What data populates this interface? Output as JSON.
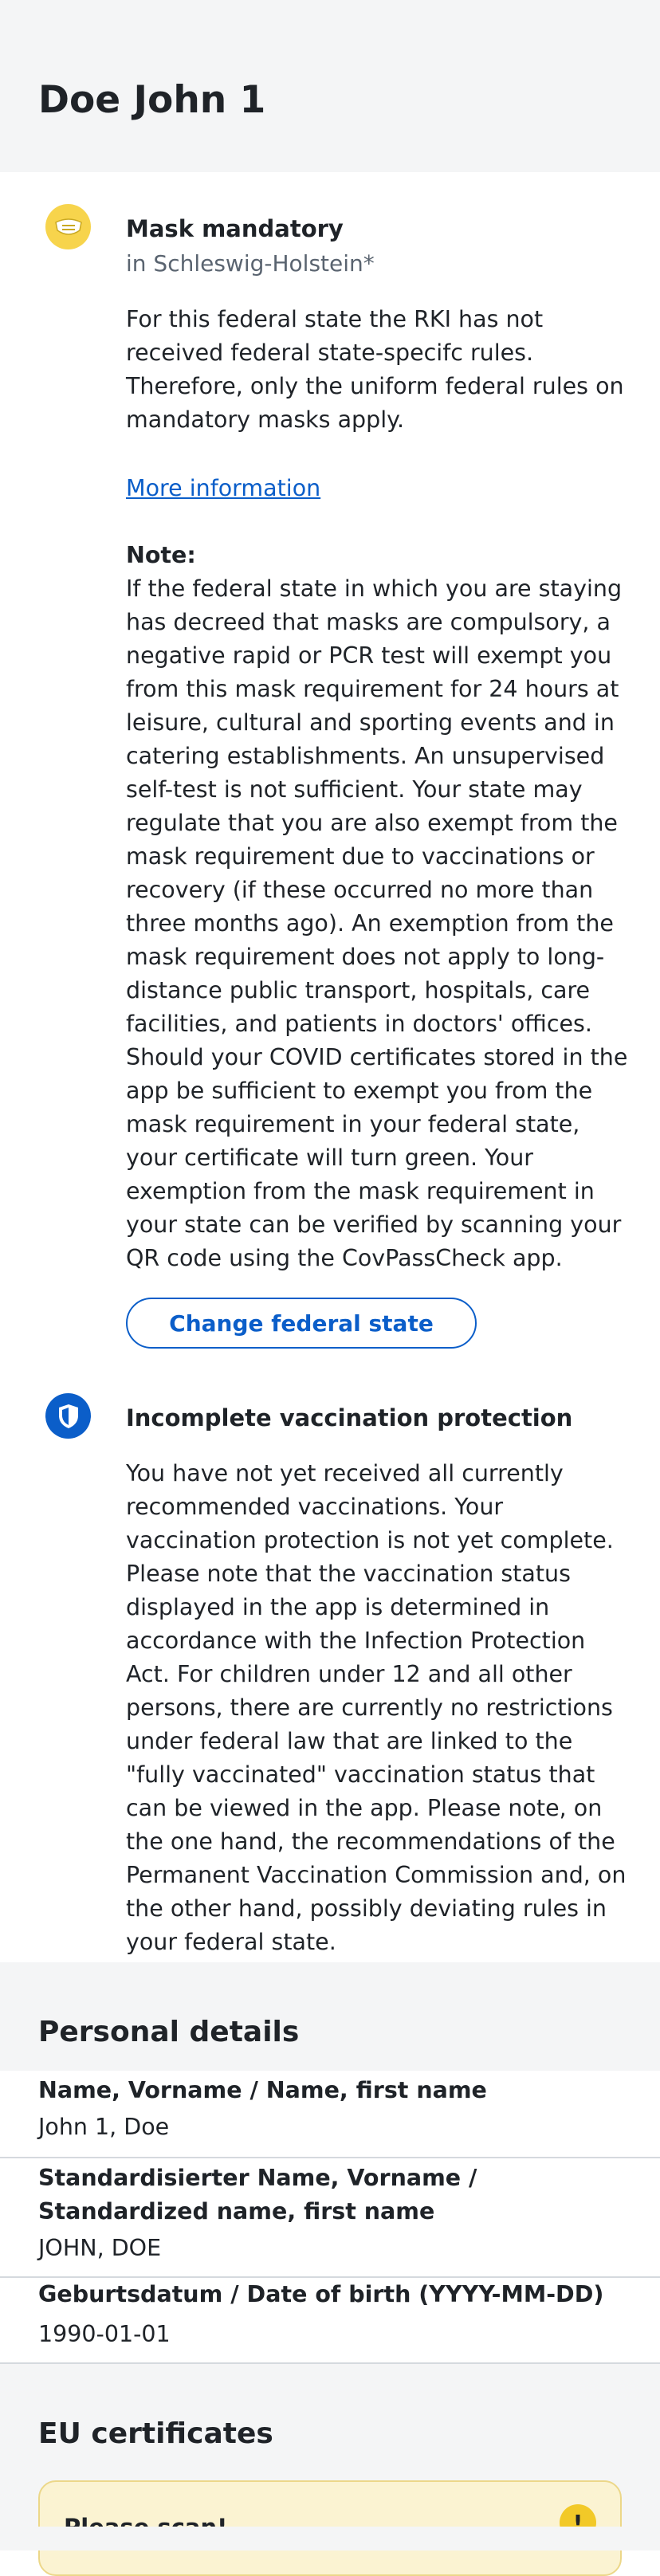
{
  "header": {
    "title": "Doe John 1"
  },
  "mask": {
    "title": "Mask mandatory",
    "subtitle": "in Schleswig-Holstein*",
    "text": "For this federal state the RKI has not received federal state-specifc rules. Therefore, only the uniform federal rules on mandatory masks apply.",
    "more_info": "More information",
    "note_label": "Note:",
    "note_text": "If the federal state in which you are staying has decreed that masks are compulsory, a negative rapid or PCR test will exempt you from this mask requirement for 24 hours at leisure, cultural and sporting events and in catering establishments. An unsupervised self-test is not sufficient. Your state may regulate that you are also exempt from the mask requirement due to vaccinations or recovery (if these occurred no more than three months ago). An exemption from the mask requirement does not apply to long-distance public transport, hospitals, care facilities, and patients in doctors' offices.",
    "certificate_text": "Should your COVID certificates stored in the app be sufficient to exempt you from the mask requirement in your federal state, your certificate will turn green. Your exemption from the mask requirement in your state can be verified by scanning your QR code using the CovPassCheck app.",
    "change_state_button": "Change federal state",
    "icon": "mask-icon",
    "icon_color": "#f7d44c"
  },
  "vaccination": {
    "title": "Incomplete vaccination protection",
    "text": "You have not yet received all currently recommended vaccinations. Your vaccination protection is not yet complete. Please note that the vaccination status displayed in the app is determined in accordance with the Infection Protection Act. For children under 12 and all other persons, there are currently no restrictions under federal law that are linked to the \"fully vaccinated\" vaccination status that can be viewed in the app. Please note, on the one hand, the recommendations of the Permanent Vaccination Commission and, on the other hand, possibly deviating rules in your federal state.",
    "icon": "shield-icon",
    "icon_color": "#0b5ec9"
  },
  "personal_details": {
    "title": "Personal details",
    "rows": [
      {
        "label": "Name, Vorname / Name, first name",
        "value": "John 1, Doe"
      },
      {
        "label": "Standardisierter Name, Vorname / Standardized name, first name",
        "value": "JOHN, DOE"
      },
      {
        "label": "Geburtsdatum / Date of birth (YYYY-MM-DD)",
        "value": "1990-01-01"
      }
    ]
  },
  "eu_certificates": {
    "title": "EU certificates",
    "card_title": "Please scan!",
    "card_icon": "warning-icon",
    "card_icon_symbol": "!"
  },
  "colors": {
    "accent": "#0b5ec9",
    "background_grey": "#f4f5f6",
    "warning_yellow": "#f2c928"
  }
}
